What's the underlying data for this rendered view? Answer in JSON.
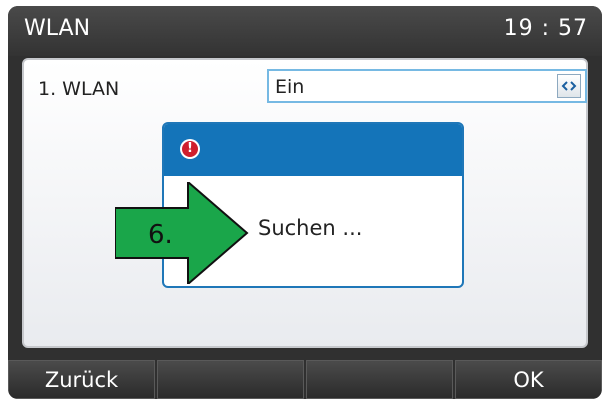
{
  "header": {
    "title": "WLAN",
    "time": "19 : 57"
  },
  "settings": {
    "row_label": "1. WLAN",
    "select_value": "Ein",
    "select_icon": "left-right-chevron-icon"
  },
  "dialog": {
    "icon": "alert-icon",
    "icon_glyph": "!",
    "message": "Suchen ..."
  },
  "annotation": {
    "step_label": "6.",
    "arrow_color": "#1aa64a"
  },
  "softkeys": {
    "back": "Zurück",
    "key2": "",
    "key3": "",
    "ok": "OK"
  },
  "colors": {
    "accent": "#1474b9",
    "alert": "#cf1f2e",
    "select_border": "#76b9e3"
  }
}
